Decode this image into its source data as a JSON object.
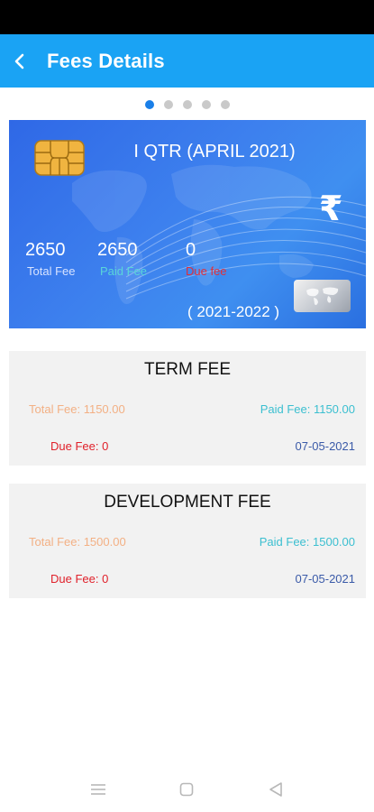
{
  "appbar": {
    "title": "Fees Details"
  },
  "pager": {
    "count": 5,
    "active_index": 0
  },
  "card": {
    "period": "I QTR (APRIL 2021)",
    "currency_symbol": "₹",
    "total_fee": "2650",
    "total_fee_label": "Total Fee",
    "paid_fee": "2650",
    "paid_fee_label": "Paid Fee",
    "due_fee": "0",
    "due_fee_label": "Due fee",
    "year": "( 2021-2022 )"
  },
  "fees": [
    {
      "title": "TERM FEE",
      "total": "Total Fee: 1150.00",
      "paid": "Paid Fee: 1150.00",
      "due": "Due Fee: 0",
      "date": "07-05-2021"
    },
    {
      "title": "DEVELOPMENT FEE",
      "total": "Total Fee: 1500.00",
      "paid": "Paid Fee: 1500.00",
      "due": "Due Fee: 0",
      "date": "07-05-2021"
    }
  ],
  "colors": {
    "appbar": "#1aa3f4",
    "card_gradient_start": "#2f68e6",
    "card_gradient_end": "#3f8ff0",
    "total_label": "#f3b084",
    "paid_label": "#3bbfd0",
    "due_label": "#e0202a",
    "date": "#3a5aa8"
  },
  "icons": {
    "back": "back-arrow-icon",
    "chip": "sim-chip-icon",
    "map": "world-map-icon",
    "nav_menu": "menu-icon",
    "nav_home": "home-square-icon",
    "nav_back": "back-triangle-icon"
  }
}
